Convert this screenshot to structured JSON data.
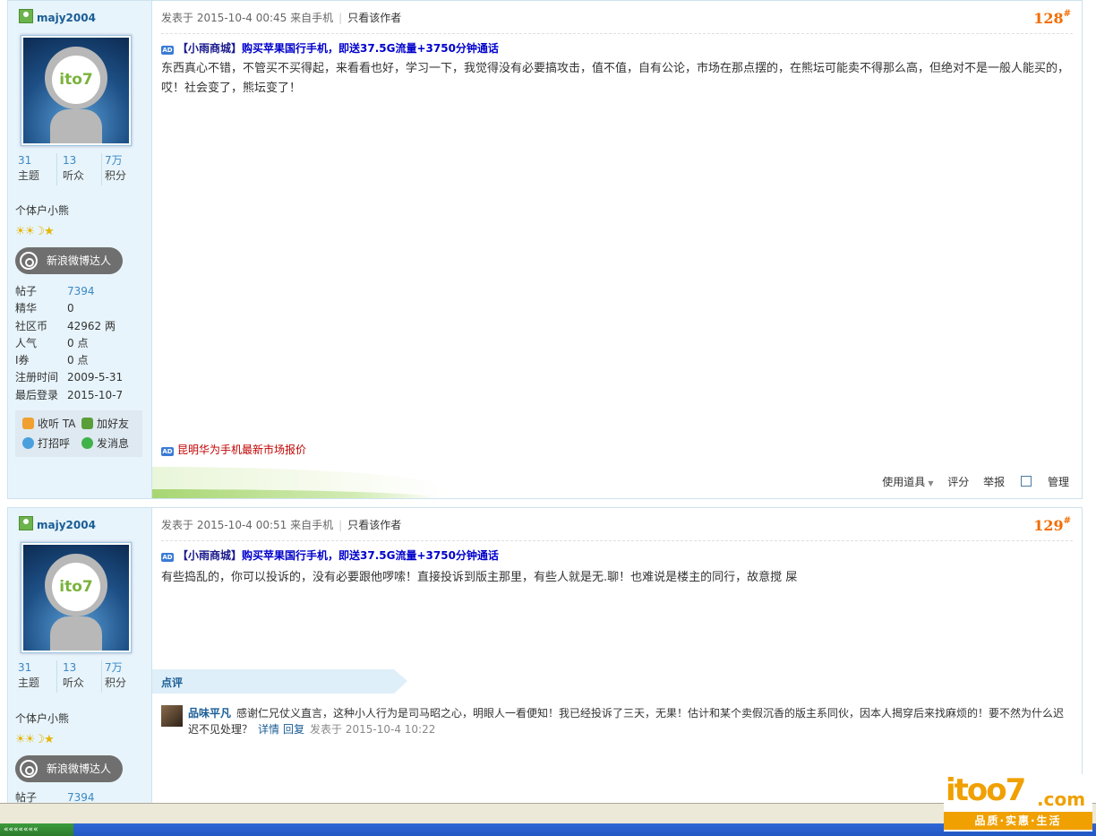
{
  "posts": [
    {
      "username": "majy2004",
      "stats": [
        {
          "value": "31",
          "label": "主题"
        },
        {
          "value": "13",
          "label": "听众"
        },
        {
          "value": "7万",
          "label": "积分"
        }
      ],
      "group": "个体户小熊",
      "stars": "☀☀☽★",
      "weibo_badge": "新浪微博达人",
      "info": [
        {
          "key": "帖子",
          "value": "7394"
        },
        {
          "key": "精华",
          "value": "0"
        },
        {
          "key": "社区币",
          "value": "42962 两"
        },
        {
          "key": "人气",
          "value": "0 点"
        },
        {
          "key": "I券",
          "value": "0 点"
        },
        {
          "key": "注册时间",
          "value": "2009-5-31"
        },
        {
          "key": "最后登录",
          "value": "2015-10-7"
        }
      ],
      "actions": [
        "收听 TA",
        "加好友",
        "打招呼",
        "发消息"
      ],
      "meta": "发表于 2015-10-4 00:45 来自手机",
      "only_author": "只看该作者",
      "floor": "128",
      "floor_mark": "#",
      "ad_shop": "【小雨商城】",
      "ad_promo": "购买苹果国行手机，即送37.5G流量+3750分钟通话",
      "ad_icon": "AD",
      "content": "东西真心不错，不管买不买得起，来看看也好，学习一下，我觉得没有必要搞攻击，值不值，自有公论，市场在那点摆的，在熊坛可能卖不得那么高，但绝对不是一般人能买的，哎！社会变了，熊坛变了！",
      "bottom_ad": "昆明华为手机最新市场报价",
      "tools": {
        "use_items": "使用道具",
        "rate": "评分",
        "report": "举报",
        "manage": "管理"
      }
    },
    {
      "username": "majy2004",
      "stats": [
        {
          "value": "31",
          "label": "主题"
        },
        {
          "value": "13",
          "label": "听众"
        },
        {
          "value": "7万",
          "label": "积分"
        }
      ],
      "group": "个体户小熊",
      "stars": "☀☀☽★",
      "weibo_badge": "新浪微博达人",
      "info_first": {
        "key": "帖子",
        "value": "7394"
      },
      "meta": "发表于 2015-10-4 00:51 来自手机",
      "only_author": "只看该作者",
      "floor": "129",
      "floor_mark": "#",
      "ad_shop": "【小雨商城】",
      "ad_promo": "购买苹果国行手机，即送37.5G流量+3750分钟通话",
      "ad_icon": "AD",
      "content": "有些捣乱的，你可以投诉的，没有必要跟他啰嗦！直接投诉到版主那里，有些人就是无.聊！也难说是楼主的同行，故意搅 屎",
      "review_title": "点评",
      "review": {
        "user": "品味平凡",
        "text": "感谢仁兄仗义直言，这种小人行为是司马昭之心，明眼人一看便知！我已经投诉了三天，无果！估计和某个卖假沉香的版主系同伙，因本人揭穿后来找麻烦的！要不然为什么迟迟不见处理？",
        "detail": "详情",
        "reply": "回复",
        "time": "发表于 2015-10-4 10:22"
      }
    }
  ],
  "avatar_logo": "ito7",
  "watermark": {
    "brand": "itoo7",
    "domain": ".com",
    "tagline": "品质·实惠·生活"
  },
  "taskbar_text": "«««««««"
}
